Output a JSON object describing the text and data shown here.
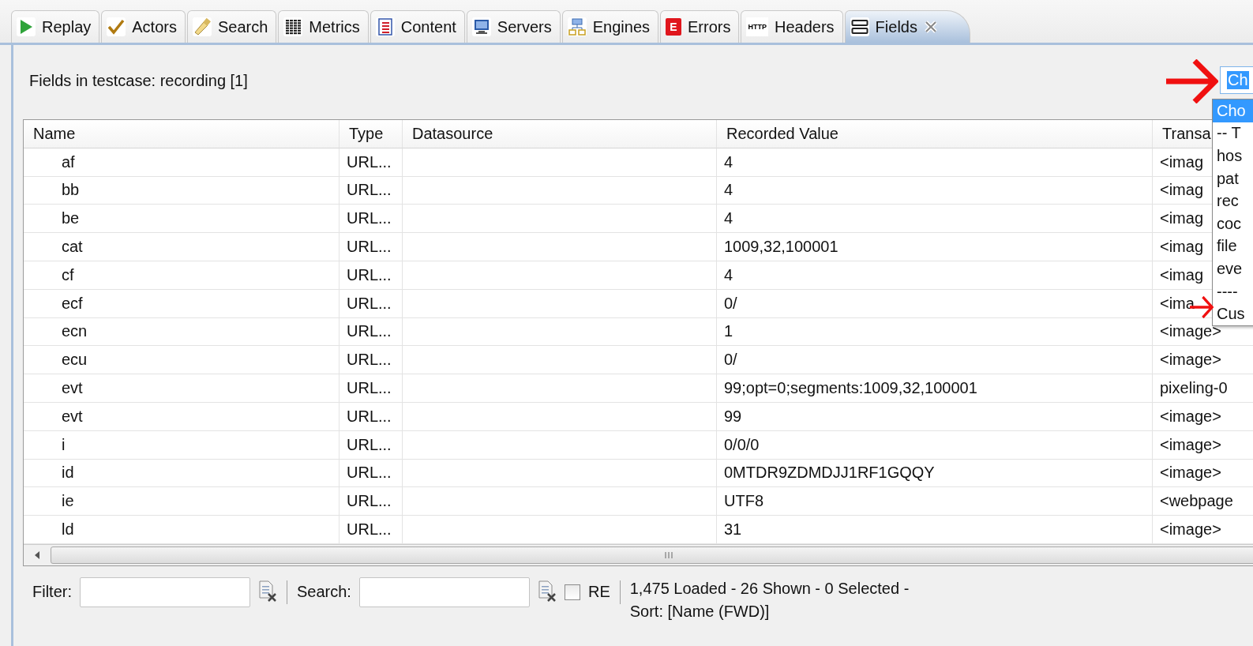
{
  "tabs": [
    {
      "label": "Replay",
      "selected": false,
      "closable": false
    },
    {
      "label": "Actors",
      "selected": false,
      "closable": false
    },
    {
      "label": "Search",
      "selected": false,
      "closable": false
    },
    {
      "label": "Metrics",
      "selected": false,
      "closable": false
    },
    {
      "label": "Content",
      "selected": false,
      "closable": false
    },
    {
      "label": "Servers",
      "selected": false,
      "closable": false
    },
    {
      "label": "Engines",
      "selected": false,
      "closable": false
    },
    {
      "label": "Errors",
      "icon_text": "E",
      "selected": false,
      "closable": false
    },
    {
      "label": "Headers",
      "icon_text": "HTTP",
      "selected": false,
      "closable": false
    },
    {
      "label": "Fields",
      "selected": true,
      "closable": true
    }
  ],
  "heading": "Fields in testcase: recording [1]",
  "chooser": {
    "value": "Ch",
    "options": [
      {
        "label": "Cho",
        "selected": true
      },
      {
        "label": "-- T",
        "selected": false
      },
      {
        "label": "hos",
        "selected": false
      },
      {
        "label": "pat",
        "selected": false
      },
      {
        "label": "rec",
        "selected": false
      },
      {
        "label": "coc",
        "selected": false
      },
      {
        "label": "file",
        "selected": false
      },
      {
        "label": "eve",
        "selected": false
      },
      {
        "label": "----",
        "selected": false
      },
      {
        "label": "Cus",
        "selected": false
      }
    ]
  },
  "table": {
    "columns": [
      "Name",
      "Type",
      "Datasource",
      "Recorded Value",
      "Transa"
    ],
    "rows": [
      [
        "af",
        "URL...",
        "",
        "4",
        "<imag"
      ],
      [
        "bb",
        "URL...",
        "",
        "4",
        "<imag"
      ],
      [
        "be",
        "URL...",
        "",
        "4",
        "<imag"
      ],
      [
        "cat",
        "URL...",
        "",
        "1009,32,100001",
        "<imag"
      ],
      [
        "cf",
        "URL...",
        "",
        "4",
        "<imag"
      ],
      [
        "ecf",
        "URL...",
        "",
        "0/",
        "<ima"
      ],
      [
        "ecn",
        "URL...",
        "",
        "1",
        "<image>"
      ],
      [
        "ecu",
        "URL...",
        "",
        "0/",
        "<image>"
      ],
      [
        "evt",
        "URL...",
        "",
        "99;opt=0;segments:1009,32,100001",
        "pixeling-0"
      ],
      [
        "evt",
        "URL...",
        "",
        "99",
        "<image>"
      ],
      [
        "i",
        "URL...",
        "",
        "0/0/0",
        "<image>"
      ],
      [
        "id",
        "URL...",
        "",
        "0MTDR9ZDMDJJ1RF1GQQY",
        "<image>"
      ],
      [
        "ie",
        "URL...",
        "",
        "UTF8",
        "<webpage"
      ],
      [
        "ld",
        "URL...",
        "",
        "31",
        "<image>"
      ]
    ]
  },
  "footer": {
    "filter_label": "Filter:",
    "search_label": "Search:",
    "re": {
      "label": "RE",
      "checked": false
    },
    "status": [
      "1,475 Loaded - 26 Shown - 0 Selected -",
      "Sort: [Name (FWD)]"
    ]
  }
}
